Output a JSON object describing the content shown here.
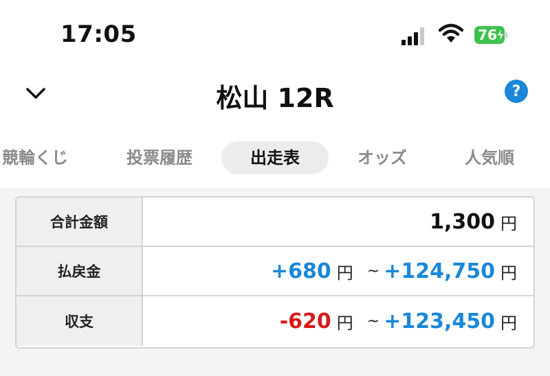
{
  "status_bar": {
    "time": "17:05",
    "battery_level": "76",
    "icons": [
      "signal-icon",
      "wifi-icon",
      "battery-icon"
    ]
  },
  "header": {
    "title": "松山 12R",
    "back_icon": "chevron-down-icon",
    "help_label": "?"
  },
  "tabs": [
    {
      "label": "競輪くじ"
    },
    {
      "label": "投票履歴"
    },
    {
      "label": "出走表"
    },
    {
      "label": "オッズ"
    },
    {
      "label": "人気順"
    }
  ],
  "active_tab": "出走表",
  "summary": {
    "total": {
      "label": "合計金額",
      "amount": "1,300",
      "unit": "円"
    },
    "payout": {
      "label": "払戻金",
      "min": "+680",
      "min_unit": "円",
      "tilde": "~",
      "max": "+124,750",
      "max_unit": "円"
    },
    "balance": {
      "label": "収支",
      "min": "-620",
      "min_unit": "円",
      "tilde": "~",
      "max": "+123,450",
      "max_unit": "円"
    }
  },
  "colors": {
    "accent_blue": "#1a87d9",
    "negative_red": "#d81a1a",
    "battery_green": "#3fc24c"
  }
}
